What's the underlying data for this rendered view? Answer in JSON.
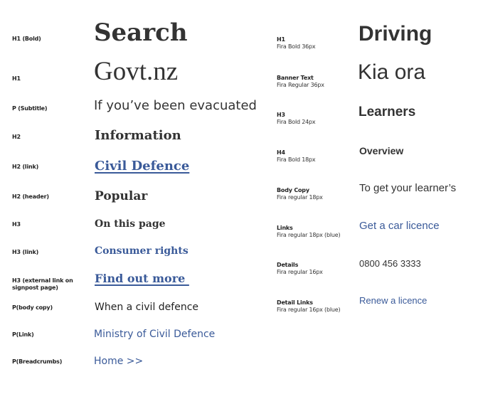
{
  "left_column": {
    "rows": [
      {
        "label": "H1 (Bold)",
        "sample": "Search"
      },
      {
        "label": "H1",
        "sample": "Govt.nz"
      },
      {
        "label": "P (Subtitle)",
        "sample": "If you’ve been evacuated"
      },
      {
        "label": "H2",
        "sample": "Information"
      },
      {
        "label": "H2 (link)",
        "sample": "Civil Defence"
      },
      {
        "label": "H2 (header)",
        "sample": "Popular"
      },
      {
        "label": "H3",
        "sample": "On this page"
      },
      {
        "label": "H3 (link)",
        "sample": "Consumer rights"
      },
      {
        "label": "H3 (external link on signpost page)",
        "sample": "Find out more "
      },
      {
        "label": "P(body copy)",
        "sample": "When a civil defence"
      },
      {
        "label": "P(Link)",
        "sample": "Ministry of Civil Defence"
      },
      {
        "label": "P(Breadcrumbs)",
        "sample": "Home >>"
      }
    ]
  },
  "right_column": {
    "rows": [
      {
        "label": "H1",
        "sublabel": "Fira Bold 36px",
        "sample": "Driving"
      },
      {
        "label": "Banner Text",
        "sublabel": "Fira Regular 36px",
        "sample": "Kia ora"
      },
      {
        "label": "H3",
        "sublabel": "Fira Bold 24px",
        "sample": "Learners"
      },
      {
        "label": "H4",
        "sublabel": "Fira Bold 18px",
        "sample": "Overview"
      },
      {
        "label": "Body Copy",
        "sublabel": "Fira regular 18px",
        "sample": "To get your learner’s"
      },
      {
        "label": "Links",
        "sublabel": "Fira regular 18px (blue)",
        "sample": "Get a car licence"
      },
      {
        "label": "Details",
        "sublabel": "Fira regular 16px",
        "sample": "0800 456 3333"
      },
      {
        "label": "Detail Links",
        "sublabel": "Fira regular 16px (blue)",
        "sample": "Renew a licence"
      }
    ]
  },
  "colors": {
    "text": "#333333",
    "link": "#3a5a99",
    "background": "#ffffff"
  }
}
